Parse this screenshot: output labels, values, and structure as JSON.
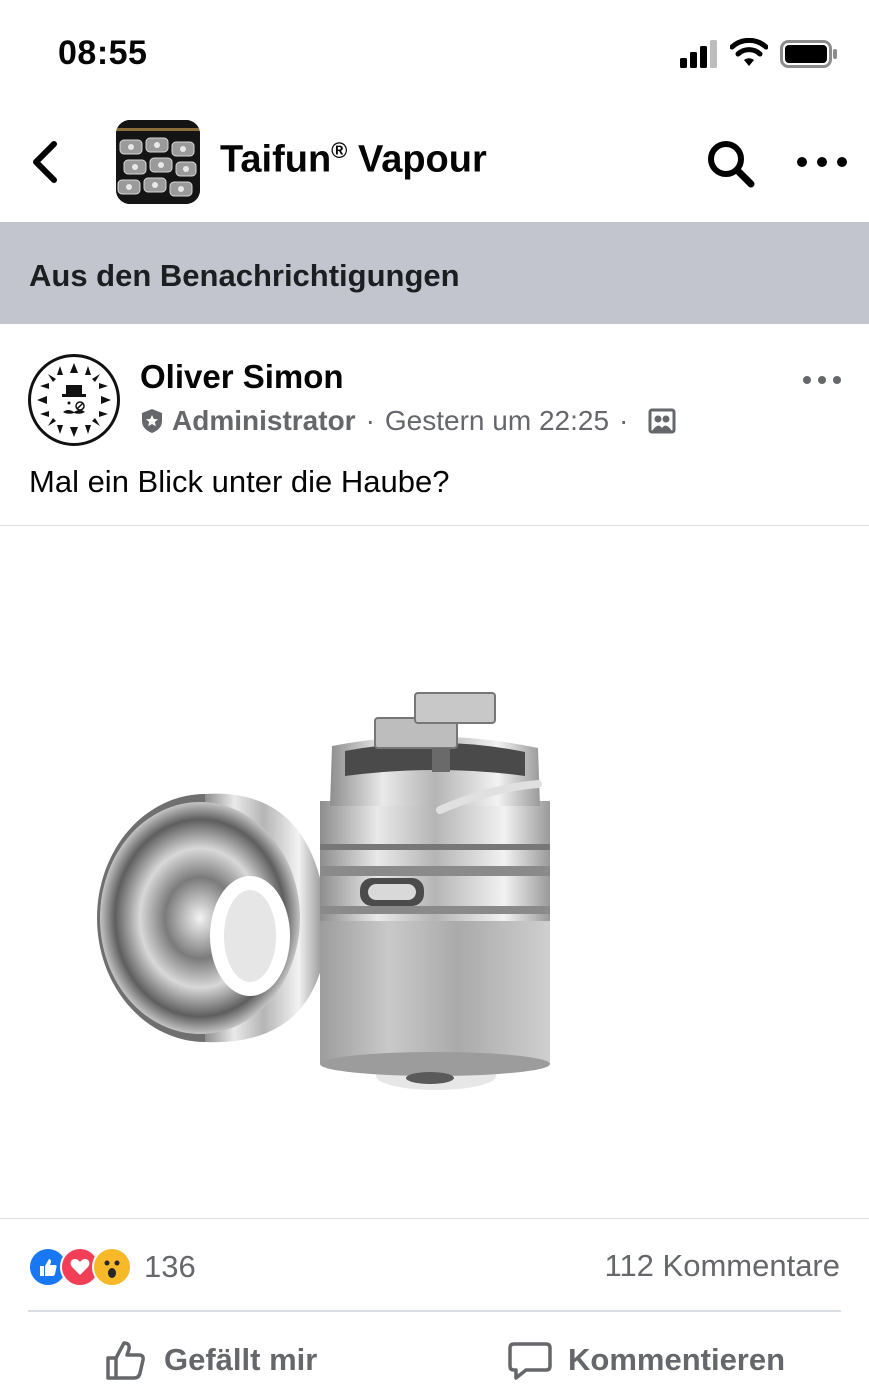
{
  "status_bar": {
    "time": "08:55"
  },
  "header": {
    "title": "Taifun",
    "title_mark": "®",
    "title_suffix": " Vapour"
  },
  "notification_banner": {
    "text": "Aus den Benachrichtigungen"
  },
  "post": {
    "author": "Oliver Simon",
    "role": "Administrator",
    "timestamp": "Gestern um 22:25",
    "text": "Mal ein Blick unter die Haube?",
    "reaction_count": "136",
    "comment_count": "112 Kommentare",
    "reactions": [
      "like-icon",
      "love-icon",
      "wow-icon"
    ]
  },
  "actions": {
    "like_label": "Gefällt mir",
    "comment_label": "Kommentieren"
  },
  "colors": {
    "banner_bg": "#c2c5cd",
    "secondary_text": "#65676b",
    "like_blue": "#1877f2",
    "love_red": "#f33e58",
    "wow_yellow": "#f7b928"
  }
}
